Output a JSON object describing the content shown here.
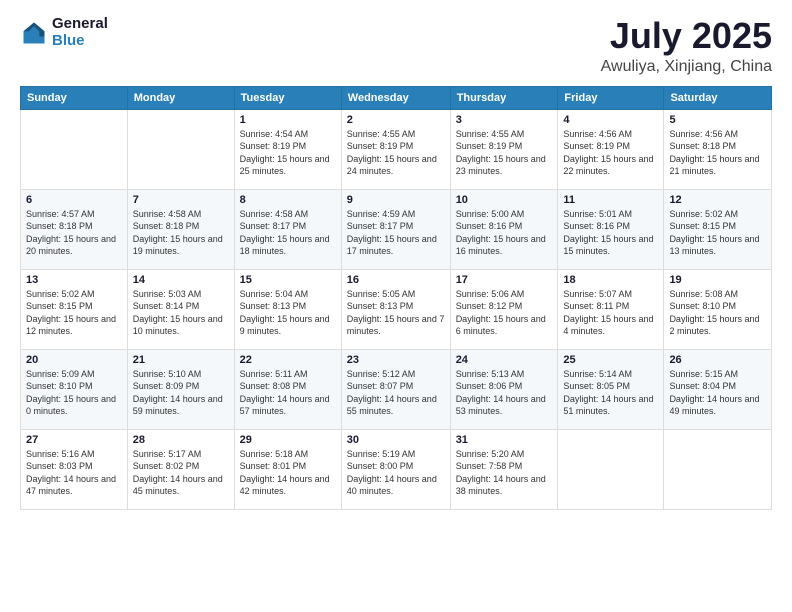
{
  "logo": {
    "general": "General",
    "blue": "Blue"
  },
  "header": {
    "month": "July 2025",
    "location": "Awuliya, Xinjiang, China"
  },
  "weekdays": [
    "Sunday",
    "Monday",
    "Tuesday",
    "Wednesday",
    "Thursday",
    "Friday",
    "Saturday"
  ],
  "weeks": [
    [
      {
        "day": "",
        "sunrise": "",
        "sunset": "",
        "daylight": ""
      },
      {
        "day": "",
        "sunrise": "",
        "sunset": "",
        "daylight": ""
      },
      {
        "day": "1",
        "sunrise": "Sunrise: 4:54 AM",
        "sunset": "Sunset: 8:19 PM",
        "daylight": "Daylight: 15 hours and 25 minutes."
      },
      {
        "day": "2",
        "sunrise": "Sunrise: 4:55 AM",
        "sunset": "Sunset: 8:19 PM",
        "daylight": "Daylight: 15 hours and 24 minutes."
      },
      {
        "day": "3",
        "sunrise": "Sunrise: 4:55 AM",
        "sunset": "Sunset: 8:19 PM",
        "daylight": "Daylight: 15 hours and 23 minutes."
      },
      {
        "day": "4",
        "sunrise": "Sunrise: 4:56 AM",
        "sunset": "Sunset: 8:19 PM",
        "daylight": "Daylight: 15 hours and 22 minutes."
      },
      {
        "day": "5",
        "sunrise": "Sunrise: 4:56 AM",
        "sunset": "Sunset: 8:18 PM",
        "daylight": "Daylight: 15 hours and 21 minutes."
      }
    ],
    [
      {
        "day": "6",
        "sunrise": "Sunrise: 4:57 AM",
        "sunset": "Sunset: 8:18 PM",
        "daylight": "Daylight: 15 hours and 20 minutes."
      },
      {
        "day": "7",
        "sunrise": "Sunrise: 4:58 AM",
        "sunset": "Sunset: 8:18 PM",
        "daylight": "Daylight: 15 hours and 19 minutes."
      },
      {
        "day": "8",
        "sunrise": "Sunrise: 4:58 AM",
        "sunset": "Sunset: 8:17 PM",
        "daylight": "Daylight: 15 hours and 18 minutes."
      },
      {
        "day": "9",
        "sunrise": "Sunrise: 4:59 AM",
        "sunset": "Sunset: 8:17 PM",
        "daylight": "Daylight: 15 hours and 17 minutes."
      },
      {
        "day": "10",
        "sunrise": "Sunrise: 5:00 AM",
        "sunset": "Sunset: 8:16 PM",
        "daylight": "Daylight: 15 hours and 16 minutes."
      },
      {
        "day": "11",
        "sunrise": "Sunrise: 5:01 AM",
        "sunset": "Sunset: 8:16 PM",
        "daylight": "Daylight: 15 hours and 15 minutes."
      },
      {
        "day": "12",
        "sunrise": "Sunrise: 5:02 AM",
        "sunset": "Sunset: 8:15 PM",
        "daylight": "Daylight: 15 hours and 13 minutes."
      }
    ],
    [
      {
        "day": "13",
        "sunrise": "Sunrise: 5:02 AM",
        "sunset": "Sunset: 8:15 PM",
        "daylight": "Daylight: 15 hours and 12 minutes."
      },
      {
        "day": "14",
        "sunrise": "Sunrise: 5:03 AM",
        "sunset": "Sunset: 8:14 PM",
        "daylight": "Daylight: 15 hours and 10 minutes."
      },
      {
        "day": "15",
        "sunrise": "Sunrise: 5:04 AM",
        "sunset": "Sunset: 8:13 PM",
        "daylight": "Daylight: 15 hours and 9 minutes."
      },
      {
        "day": "16",
        "sunrise": "Sunrise: 5:05 AM",
        "sunset": "Sunset: 8:13 PM",
        "daylight": "Daylight: 15 hours and 7 minutes."
      },
      {
        "day": "17",
        "sunrise": "Sunrise: 5:06 AM",
        "sunset": "Sunset: 8:12 PM",
        "daylight": "Daylight: 15 hours and 6 minutes."
      },
      {
        "day": "18",
        "sunrise": "Sunrise: 5:07 AM",
        "sunset": "Sunset: 8:11 PM",
        "daylight": "Daylight: 15 hours and 4 minutes."
      },
      {
        "day": "19",
        "sunrise": "Sunrise: 5:08 AM",
        "sunset": "Sunset: 8:10 PM",
        "daylight": "Daylight: 15 hours and 2 minutes."
      }
    ],
    [
      {
        "day": "20",
        "sunrise": "Sunrise: 5:09 AM",
        "sunset": "Sunset: 8:10 PM",
        "daylight": "Daylight: 15 hours and 0 minutes."
      },
      {
        "day": "21",
        "sunrise": "Sunrise: 5:10 AM",
        "sunset": "Sunset: 8:09 PM",
        "daylight": "Daylight: 14 hours and 59 minutes."
      },
      {
        "day": "22",
        "sunrise": "Sunrise: 5:11 AM",
        "sunset": "Sunset: 8:08 PM",
        "daylight": "Daylight: 14 hours and 57 minutes."
      },
      {
        "day": "23",
        "sunrise": "Sunrise: 5:12 AM",
        "sunset": "Sunset: 8:07 PM",
        "daylight": "Daylight: 14 hours and 55 minutes."
      },
      {
        "day": "24",
        "sunrise": "Sunrise: 5:13 AM",
        "sunset": "Sunset: 8:06 PM",
        "daylight": "Daylight: 14 hours and 53 minutes."
      },
      {
        "day": "25",
        "sunrise": "Sunrise: 5:14 AM",
        "sunset": "Sunset: 8:05 PM",
        "daylight": "Daylight: 14 hours and 51 minutes."
      },
      {
        "day": "26",
        "sunrise": "Sunrise: 5:15 AM",
        "sunset": "Sunset: 8:04 PM",
        "daylight": "Daylight: 14 hours and 49 minutes."
      }
    ],
    [
      {
        "day": "27",
        "sunrise": "Sunrise: 5:16 AM",
        "sunset": "Sunset: 8:03 PM",
        "daylight": "Daylight: 14 hours and 47 minutes."
      },
      {
        "day": "28",
        "sunrise": "Sunrise: 5:17 AM",
        "sunset": "Sunset: 8:02 PM",
        "daylight": "Daylight: 14 hours and 45 minutes."
      },
      {
        "day": "29",
        "sunrise": "Sunrise: 5:18 AM",
        "sunset": "Sunset: 8:01 PM",
        "daylight": "Daylight: 14 hours and 42 minutes."
      },
      {
        "day": "30",
        "sunrise": "Sunrise: 5:19 AM",
        "sunset": "Sunset: 8:00 PM",
        "daylight": "Daylight: 14 hours and 40 minutes."
      },
      {
        "day": "31",
        "sunrise": "Sunrise: 5:20 AM",
        "sunset": "Sunset: 7:58 PM",
        "daylight": "Daylight: 14 hours and 38 minutes."
      },
      {
        "day": "",
        "sunrise": "",
        "sunset": "",
        "daylight": ""
      },
      {
        "day": "",
        "sunrise": "",
        "sunset": "",
        "daylight": ""
      }
    ]
  ]
}
